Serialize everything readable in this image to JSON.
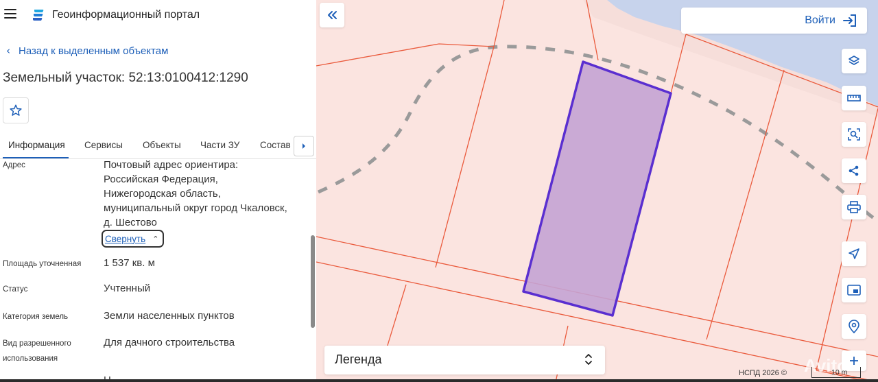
{
  "header": {
    "title": "Геоинформационный портал"
  },
  "navigation": {
    "back_label": "Назад к выделенным объектам"
  },
  "parcel": {
    "title": "Земельный участок: 52:13:0100412:1290"
  },
  "tabs": [
    {
      "label": "Информация",
      "active": true
    },
    {
      "label": "Сервисы"
    },
    {
      "label": "Объекты"
    },
    {
      "label": "Части ЗУ"
    },
    {
      "label": "Состав"
    }
  ],
  "info": {
    "address_label": "Адрес",
    "address_lines": [
      "Почтовый адрес ориентира:",
      "Российская Федерация,",
      "Нижегородская область,",
      "муниципальный округ город Чкаловск,",
      "д. Шестово"
    ],
    "collapse_label": "Свернуть",
    "area_label": "Площадь уточненная",
    "area_value": "1 537 кв. м",
    "status_label": "Статус",
    "status_value": "Учтенный",
    "category_label": "Категория земель",
    "category_value": "Земли населенных пунктов",
    "use_label_line1": "Вид разрешенного",
    "use_label_line2": "использования",
    "use_value": "Для дачного строительства",
    "next_value_fragment": "Н"
  },
  "map": {
    "login_label": "Войти",
    "legend_label": "Легенда",
    "credit": "НСПД 2026 ©",
    "scale_label": "10 m",
    "watermark": "Avito",
    "colors": {
      "land": "#fbe4e0",
      "water": "#c7d3ec",
      "parcel_border": "#ea5a3c",
      "selected_fill": "#c4a3d4",
      "selected_stroke": "#5a2fd0",
      "accent": "#1d5fb8"
    }
  },
  "icons": {
    "menu": "hamburger-icon",
    "logo": "portal-logo-icon",
    "favorite": "star-icon",
    "layers": "layers-icon",
    "ruler": "ruler-icon",
    "select": "select-area-icon",
    "share": "share-icon",
    "print": "print-icon",
    "locate": "location-arrow-icon",
    "minimap": "minimap-icon",
    "geo": "geo-search-icon",
    "zoom_in": "plus-icon"
  }
}
